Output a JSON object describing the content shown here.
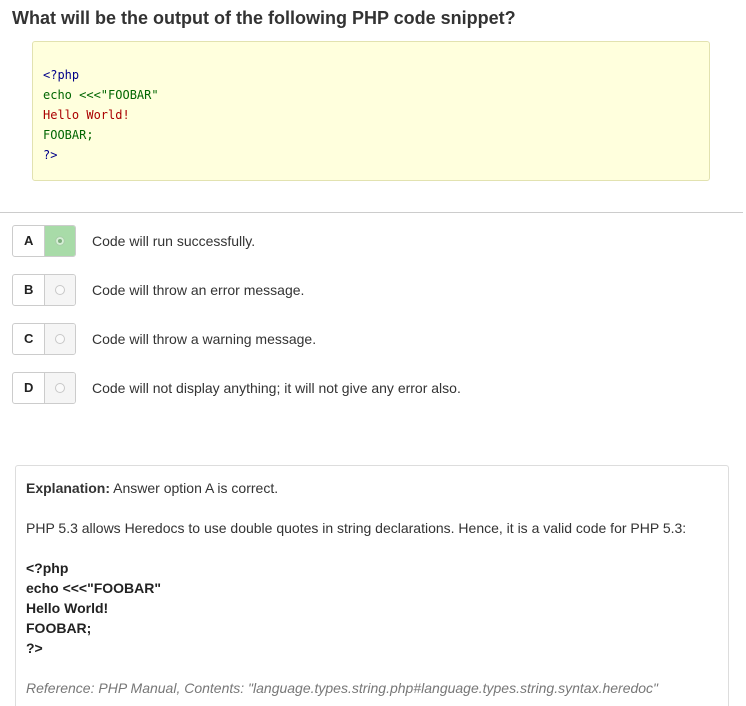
{
  "question": "What will be the output of the following PHP code snippet?",
  "code": {
    "lines": [
      "<?php",
      "echo <<<\"FOOBAR\"",
      "Hello World!",
      "FOOBAR;",
      "?>"
    ]
  },
  "options": [
    {
      "letter": "A",
      "text": "Code will run successfully.",
      "selected": true
    },
    {
      "letter": "B",
      "text": "Code will throw an error message.",
      "selected": false
    },
    {
      "letter": "C",
      "text": "Code will throw a warning message.",
      "selected": false
    },
    {
      "letter": "D",
      "text": "Code will not display anything; it will not give any error also.",
      "selected": false
    }
  ],
  "explanation": {
    "label": "Explanation:",
    "answer": " Answer option A is correct.",
    "body": "PHP 5.3 allows Heredocs to use double quotes in string declarations. Hence, it is a valid code for PHP 5.3:",
    "code_lines": [
      "<?php",
      "echo <<<\"FOOBAR\"",
      "Hello World!",
      "FOOBAR;",
      "?>"
    ],
    "reference": "Reference: PHP Manual, Contents: \"language.types.string.php#language.types.string.syntax.heredoc\""
  },
  "colors": {
    "code_background": "#ffffdd",
    "selected_option": "#a8dba8",
    "code_keyword": "#000088",
    "code_string": "#006600",
    "code_text": "#aa0000"
  }
}
